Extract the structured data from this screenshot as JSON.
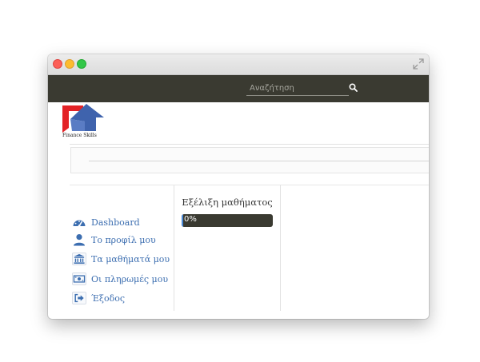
{
  "search": {
    "placeholder": "Αναζήτηση",
    "value": ""
  },
  "logo": {
    "text": "Finance Skills"
  },
  "sidebar": {
    "items": [
      {
        "label": "Dashboard",
        "icon": "dashboard-icon"
      },
      {
        "label": "Το προφίλ μου",
        "icon": "user-icon"
      },
      {
        "label": "Τα μαθήματά μου",
        "icon": "institution-icon"
      },
      {
        "label": "Οι πληρωμές μου",
        "icon": "money-icon"
      },
      {
        "label": "Έξοδος",
        "icon": "sign-out-icon"
      }
    ]
  },
  "progress": {
    "title": "Εξέλιξη μαθήματος",
    "value_label": "0%",
    "value": 0
  },
  "colors": {
    "navbar": "#3a3a31",
    "link": "#3c6eb0",
    "logo_red": "#e32226",
    "logo_blue": "#3f63ad"
  }
}
